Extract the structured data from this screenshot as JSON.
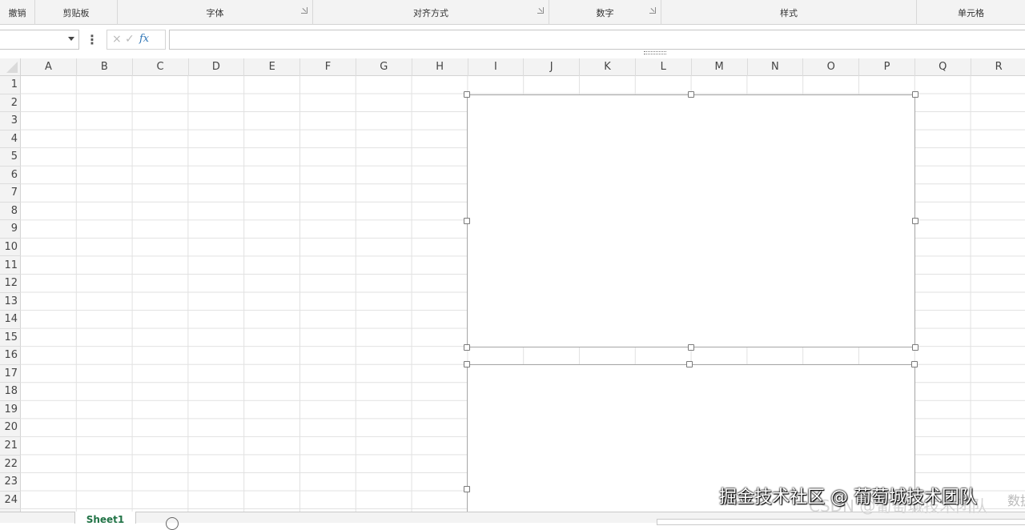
{
  "ribbon": {
    "groups": [
      {
        "label": "撤销",
        "launcher": false
      },
      {
        "label": "剪贴板",
        "launcher": false
      },
      {
        "label": "字体",
        "launcher": true
      },
      {
        "label": "对齐方式",
        "launcher": true
      },
      {
        "label": "数字",
        "launcher": true
      },
      {
        "label": "样式",
        "launcher": false
      },
      {
        "label": "单元格",
        "launcher": false
      }
    ]
  },
  "formula_bar": {
    "name_box_value": "",
    "cancel_icon": "×",
    "enter_icon": "✓",
    "fx_label": "fx",
    "formula_value": ""
  },
  "columns": [
    "A",
    "B",
    "C",
    "D",
    "E",
    "F",
    "G",
    "H",
    "I",
    "J",
    "K",
    "L",
    "M",
    "N",
    "O",
    "P",
    "Q",
    "R"
  ],
  "rows": [
    "1",
    "2",
    "3",
    "4",
    "5",
    "6",
    "7",
    "8",
    "9",
    "10",
    "11",
    "12",
    "13",
    "14",
    "15",
    "16",
    "17",
    "18",
    "19",
    "20",
    "21",
    "22",
    "23",
    "24"
  ],
  "sheets": {
    "active": "Sheet1"
  },
  "watermark": {
    "text": "掘金技术社区 @ 葡萄城技术团队",
    "background_text": "CSDN @葡萄城技术团队",
    "edge_text": "数据"
  }
}
